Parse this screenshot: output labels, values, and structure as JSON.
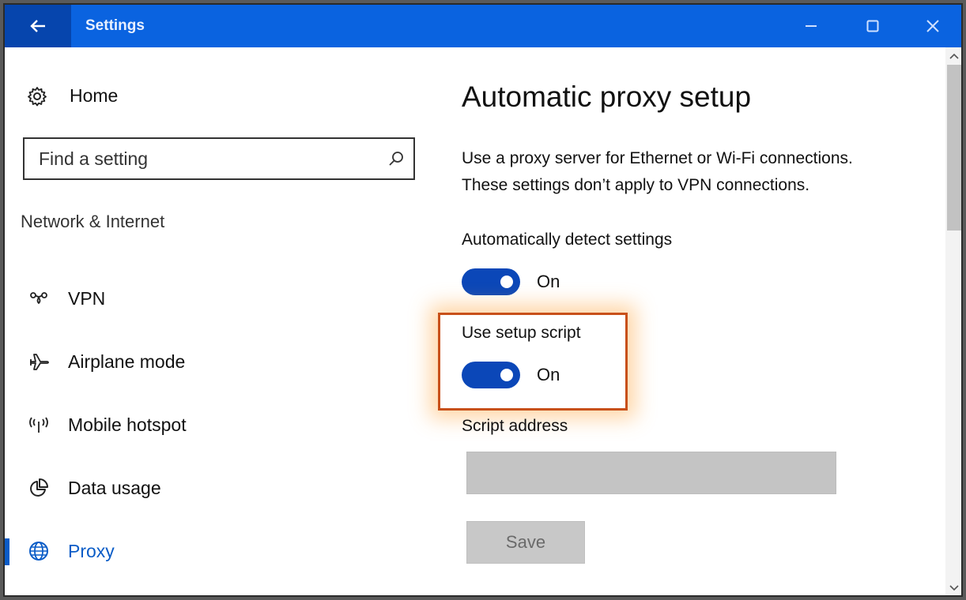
{
  "window": {
    "title": "Settings",
    "controls": [
      "minimize",
      "maximize",
      "close"
    ]
  },
  "colors": {
    "titlebar": "#0a63e0",
    "back_button": "#0645ad",
    "accent": "#0a5cc7",
    "toggle_on": "#0b47b8",
    "highlight_border": "#c8501a"
  },
  "sidebar": {
    "home_label": "Home",
    "search": {
      "placeholder": "Find a setting",
      "value": ""
    },
    "section_label": "Network & Internet",
    "items": [
      {
        "label": "VPN",
        "icon": "vpn-icon",
        "active": false
      },
      {
        "label": "Airplane mode",
        "icon": "airplane-icon",
        "active": false
      },
      {
        "label": "Mobile hotspot",
        "icon": "hotspot-icon",
        "active": false
      },
      {
        "label": "Data usage",
        "icon": "data-usage-icon",
        "active": false
      },
      {
        "label": "Proxy",
        "icon": "globe-icon",
        "active": true
      }
    ]
  },
  "main": {
    "title": "Automatic proxy setup",
    "description_line1": "Use a proxy server for Ethernet or Wi-Fi connections.",
    "description_line2": "These settings don’t apply to VPN connections.",
    "auto_detect": {
      "label": "Automatically detect settings",
      "state": "On",
      "enabled": true
    },
    "setup_script": {
      "label": "Use setup script",
      "state": "On",
      "enabled": true,
      "highlighted": true
    },
    "script_address": {
      "label": "Script address",
      "value": ""
    },
    "save_label": "Save"
  }
}
